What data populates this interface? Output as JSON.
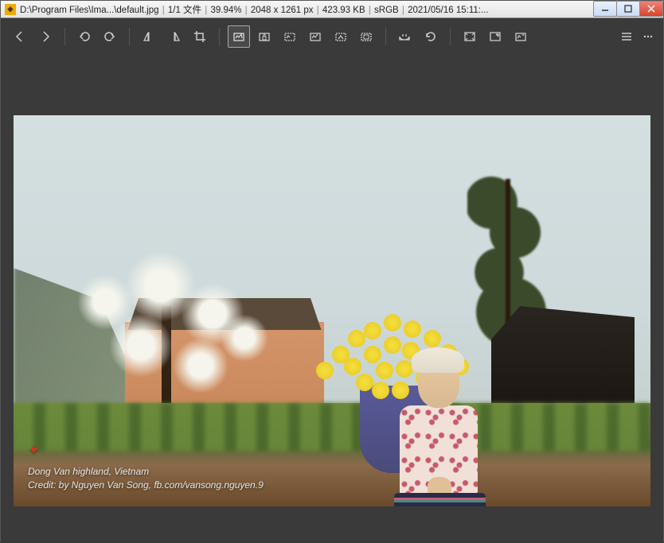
{
  "titlebar": {
    "path": "D:\\Program Files\\Ima...\\default.jpg",
    "file_index": "1/1 文件",
    "zoom": "39.94%",
    "dimensions": "2048 x 1261 px",
    "filesize": "423.93 KB",
    "colorspace": "sRGB",
    "datetime": "2021/05/16 15:11:..."
  },
  "caption": {
    "line1": "Dong Van highland, Vietnam",
    "line2": "Credit: by Nguyen Van Song, fb.com/vansong.nguyen.9"
  }
}
